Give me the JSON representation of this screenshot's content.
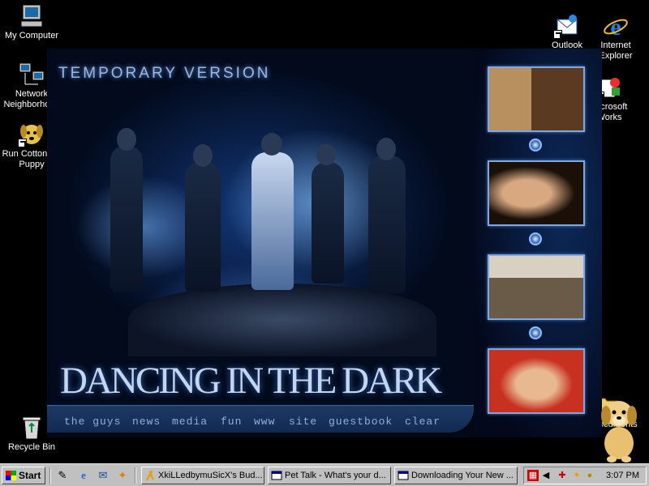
{
  "desktop": {
    "icons": [
      {
        "label": "My Computer"
      },
      {
        "label": "Network Neighborhood"
      },
      {
        "label": "Run Cottonelle Puppy"
      },
      {
        "label": "Recycle Bin"
      },
      {
        "label": "Outlook Express"
      },
      {
        "label": "Internet Explorer"
      },
      {
        "label": "Microsoft Works"
      },
      {
        "label": "My Documents"
      }
    ]
  },
  "website": {
    "header": "TEMPORARY VERSION",
    "title": "DANCING IN THE DARK",
    "nav": [
      "the guys",
      "news",
      "media",
      "fun",
      "www",
      "site",
      "guestbook",
      "clear"
    ]
  },
  "taskbar": {
    "start_label": "Start",
    "tasks": [
      {
        "label": "XkiLLedbymuSicX's Bud..."
      },
      {
        "label": "Pet Talk - What's your d..."
      },
      {
        "label": "Downloading Your New ..."
      }
    ],
    "clock": "3:07 PM"
  },
  "colors": {
    "desktop": "#000000",
    "taskbar": "#c0c0c0",
    "site_accent": "#7fa8e0"
  }
}
